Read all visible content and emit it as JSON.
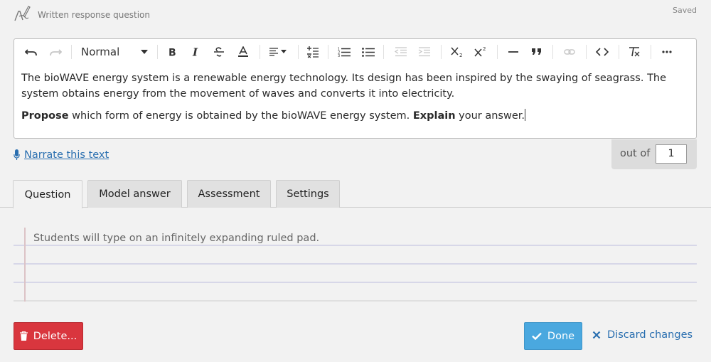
{
  "header": {
    "title": "Written response question",
    "status": "Saved",
    "icon": "pencil-edit-icon"
  },
  "toolbar": {
    "format_label": "Normal",
    "buttons": [
      "undo-icon",
      "redo-icon",
      "bold-icon",
      "italic-icon",
      "strikethrough-icon",
      "font-color-icon",
      "align-icon",
      "formula-icon",
      "ordered-list-icon",
      "bullet-list-icon",
      "outdent-icon",
      "indent-icon",
      "subscript-icon",
      "superscript-icon",
      "horizontal-rule-icon",
      "blockquote-icon",
      "link-icon",
      "code-icon",
      "clear-format-icon",
      "more-icon"
    ]
  },
  "editor": {
    "paragraph1": "The bioWAVE energy system is a renewable energy technology. Its design has been inspired by the swaying of seagrass. The system obtains energy from the movement of waves and converts it into electricity.",
    "p2_bold1": "Propose",
    "p2_text1": " which form of energy is obtained by the bioWAVE energy system. ",
    "p2_bold2": "Explain",
    "p2_text2": " your answer."
  },
  "narrate": {
    "label": "Narrate this text"
  },
  "score": {
    "label": "out of",
    "value": "1"
  },
  "tabs": [
    {
      "label": "Question",
      "active": true
    },
    {
      "label": "Model answer",
      "active": false
    },
    {
      "label": "Assessment",
      "active": false
    },
    {
      "label": "Settings",
      "active": false
    }
  ],
  "pad": {
    "placeholder": "Students will type on an infinitely expanding ruled pad."
  },
  "actions": {
    "delete_label": "Delete...",
    "done_label": "Done",
    "discard_label": "Discard changes"
  },
  "colors": {
    "link": "#2a6fb0",
    "delete": "#d9363e",
    "done": "#4aa8df"
  }
}
